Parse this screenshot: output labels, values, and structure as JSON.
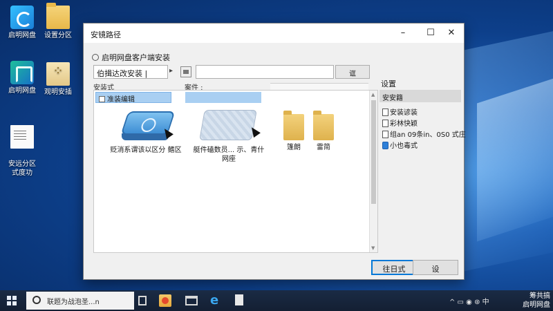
{
  "desktop": {
    "icons": [
      {
        "label": "启明网盘",
        "icon": "netdisk-icon"
      },
      {
        "label": "设置分区",
        "icon": "folder-icon"
      },
      {
        "label": "启明网盘",
        "icon": "netdisk-icon"
      },
      {
        "label": "观明安插",
        "icon": "setup-icon"
      },
      {
        "label": "安远分区\n式度功",
        "icon": "document-icon"
      }
    ]
  },
  "dialog": {
    "title": "安镜路径",
    "subtitle": "启明网盘客户端安装",
    "address_label": "伯揖达改安装 |",
    "address_arrow": "▸",
    "address_value": "",
    "address_button": "诓",
    "left_header": "安装式",
    "mid_header": "案件 :",
    "tree_item": "准装编辑",
    "files": [
      {
        "label": "贬消系谓该以区分 鳍区",
        "icon": "drive-icon"
      },
      {
        "label": "艇件磕数员... 示、青什网座",
        "icon": "box-icon"
      },
      {
        "label": "篷朗",
        "icon": "folder-icon"
      },
      {
        "label": "雷简",
        "icon": "folder-icon"
      }
    ],
    "side_title": "设置",
    "side_header": "安安籍",
    "side_items": [
      {
        "label": "安装谚装",
        "icon": "document-icon"
      },
      {
        "label": "彩林快颖",
        "icon": "document-icon"
      },
      {
        "label": "组an 09条in、0S0 式庄",
        "icon": "document-icon"
      },
      {
        "label": "小也毒式",
        "icon": "blue-app-icon"
      }
    ],
    "primary_button": "往日式",
    "cancel_button": "设"
  },
  "taskbar": {
    "search_text": "联题为战泡圣...n",
    "tray_icons": [
      "expand-icon",
      "battery-icon",
      "volume-icon",
      "network-icon",
      "input-icon"
    ],
    "tray_text": "^ ▭ ◉ ⊛ 中",
    "clock_line1": "筹共搞",
    "clock_line2": "启明网盘"
  },
  "colors": {
    "selection": "#a9cff2",
    "accent": "#0078d7",
    "desktop_bg": "#0d3f8a"
  }
}
